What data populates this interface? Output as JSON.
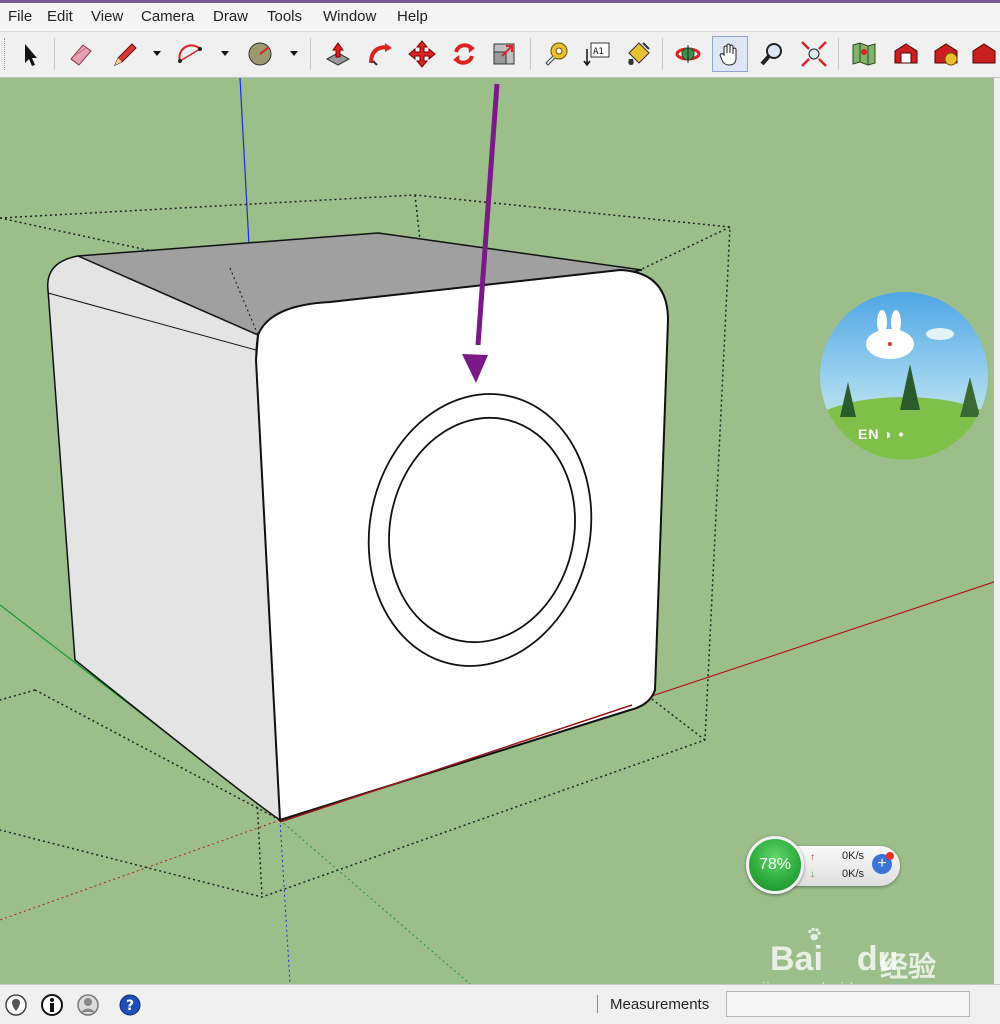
{
  "menu": {
    "items": [
      "File",
      "Edit",
      "View",
      "Camera",
      "Draw",
      "Tools",
      "Window",
      "Help"
    ]
  },
  "toolbar": {
    "tools": [
      {
        "name": "select-tool",
        "icon": "arrow-cursor-icon"
      },
      {
        "name": "eraser-tool",
        "icon": "eraser-icon"
      },
      {
        "name": "line-tool",
        "icon": "pencil-icon"
      },
      {
        "name": "arc-tool",
        "icon": "arc-icon"
      },
      {
        "name": "shape-tool",
        "icon": "circle-shape-icon"
      },
      {
        "name": "push-pull-tool",
        "icon": "push-pull-icon"
      },
      {
        "name": "follow-me-tool",
        "icon": "follow-me-icon"
      },
      {
        "name": "move-tool",
        "icon": "move-icon"
      },
      {
        "name": "rotate-tool",
        "icon": "rotate-icon"
      },
      {
        "name": "scale-tool",
        "icon": "scale-icon"
      },
      {
        "name": "tape-measure-tool",
        "icon": "tape-measure-icon"
      },
      {
        "name": "text-tool",
        "icon": "text-icon"
      },
      {
        "name": "paint-bucket-tool",
        "icon": "paint-bucket-icon"
      },
      {
        "name": "orbit-tool",
        "icon": "orbit-icon"
      },
      {
        "name": "pan-tool",
        "icon": "hand-icon"
      },
      {
        "name": "zoom-tool",
        "icon": "magnifier-icon"
      },
      {
        "name": "zoom-extents-tool",
        "icon": "zoom-extents-icon"
      },
      {
        "name": "add-location-tool",
        "icon": "map-icon"
      },
      {
        "name": "get-models-tool",
        "icon": "warehouse-icon"
      },
      {
        "name": "share-model-tool",
        "icon": "share-icon"
      },
      {
        "name": "extension-tool",
        "icon": "extension-icon"
      }
    ],
    "text_tool_glyph": "A1"
  },
  "viewport": {
    "background_color": "#9bbe8b",
    "annotation_arrow_color": "#7a1a86"
  },
  "overlay": {
    "network_percent": "78%",
    "upload_rate": "0K/s",
    "download_rate": "0K/s",
    "upload_arrow": "↑",
    "download_arrow": "↓",
    "plus_glyph": "+",
    "avatar_text": "EN ◗ •"
  },
  "watermark": {
    "brand": "Bai",
    "brand_du": "du",
    "brand_cn": "经验",
    "url": "jingyan.baidu.com"
  },
  "statusbar": {
    "measurements_label": "Measurements",
    "measurements_value": "",
    "icons": [
      "geo-location-icon",
      "credits-icon",
      "user-icon",
      "help-icon"
    ]
  }
}
